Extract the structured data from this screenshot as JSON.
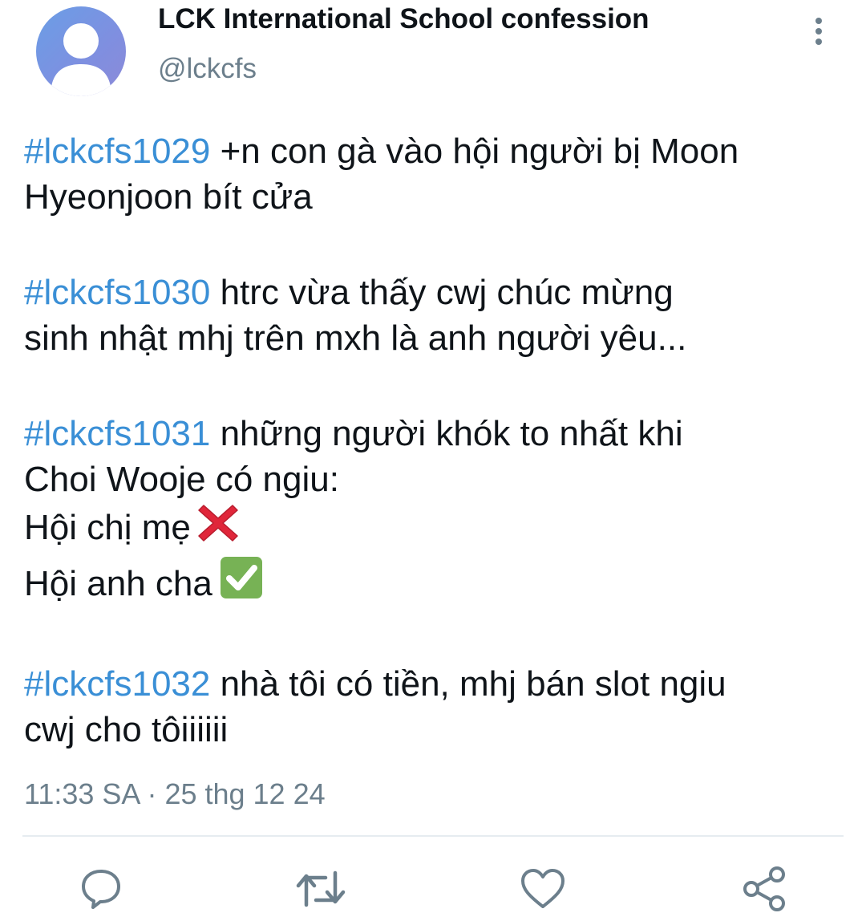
{
  "account": {
    "display_name": "LCK International School confession",
    "handle": "@lckcfs",
    "avatar_icon": "default-user-avatar-icon"
  },
  "tweet": {
    "paragraphs": [
      {
        "lines": [
          {
            "hashtag": "#lckcfs1029",
            "text": " +n con gà vào hội người bị Moon"
          },
          {
            "text": "Hyeonjoon bít cửa"
          }
        ]
      },
      {
        "lines": [
          {
            "hashtag": "#lckcfs1030",
            "text": " htrc vừa thấy cwj chúc mừng"
          },
          {
            "text": "sinh nhật mhj trên mxh là anh người yêu..."
          }
        ]
      },
      {
        "lines": [
          {
            "hashtag": "#lckcfs1031",
            "text": " những người khók to nhất khi"
          },
          {
            "text": "Choi Wooje có ngiu:"
          },
          {
            "text": "Hội chị mẹ",
            "emoji": "cross-mark-emoji"
          },
          {
            "text": "Hội anh cha",
            "emoji": "check-mark-button-emoji"
          }
        ]
      },
      {
        "lines": [
          {
            "hashtag": "#lckcfs1032",
            "text": " nhà tôi có tiền, mhj bán slot ngiu"
          },
          {
            "text": "cwj cho tôiiiiii"
          }
        ]
      }
    ],
    "timestamp": "11:33 SA · 25 thg 12 24"
  },
  "actions": {
    "reply_icon": "reply-bubble-icon",
    "retweet_icon": "retweet-icon",
    "like_icon": "heart-icon",
    "share_icon": "share-icon"
  },
  "colors": {
    "hashtag": "#3a8fd6",
    "secondary_text": "#6c7f8c",
    "primary_text": "#0f1419",
    "cross_mark": "#e0263a",
    "check_mark_bg": "#77b255"
  }
}
